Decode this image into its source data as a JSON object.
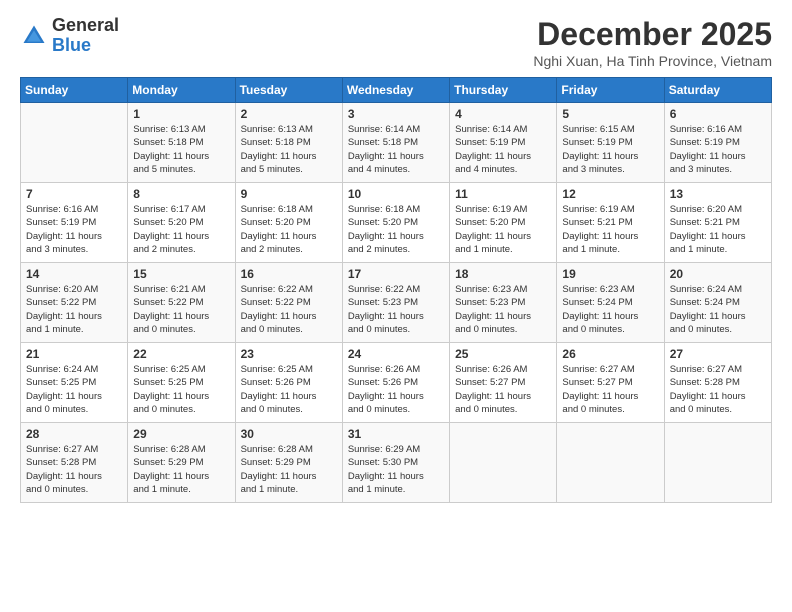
{
  "logo": {
    "general": "General",
    "blue": "Blue"
  },
  "header": {
    "month": "December 2025",
    "location": "Nghi Xuan, Ha Tinh Province, Vietnam"
  },
  "days": [
    "Sunday",
    "Monday",
    "Tuesday",
    "Wednesday",
    "Thursday",
    "Friday",
    "Saturday"
  ],
  "weeks": [
    [
      {
        "day": "",
        "content": ""
      },
      {
        "day": "1",
        "content": "Sunrise: 6:13 AM\nSunset: 5:18 PM\nDaylight: 11 hours\nand 5 minutes."
      },
      {
        "day": "2",
        "content": "Sunrise: 6:13 AM\nSunset: 5:18 PM\nDaylight: 11 hours\nand 5 minutes."
      },
      {
        "day": "3",
        "content": "Sunrise: 6:14 AM\nSunset: 5:18 PM\nDaylight: 11 hours\nand 4 minutes."
      },
      {
        "day": "4",
        "content": "Sunrise: 6:14 AM\nSunset: 5:19 PM\nDaylight: 11 hours\nand 4 minutes."
      },
      {
        "day": "5",
        "content": "Sunrise: 6:15 AM\nSunset: 5:19 PM\nDaylight: 11 hours\nand 3 minutes."
      },
      {
        "day": "6",
        "content": "Sunrise: 6:16 AM\nSunset: 5:19 PM\nDaylight: 11 hours\nand 3 minutes."
      }
    ],
    [
      {
        "day": "7",
        "content": "Sunrise: 6:16 AM\nSunset: 5:19 PM\nDaylight: 11 hours\nand 3 minutes."
      },
      {
        "day": "8",
        "content": "Sunrise: 6:17 AM\nSunset: 5:20 PM\nDaylight: 11 hours\nand 2 minutes."
      },
      {
        "day": "9",
        "content": "Sunrise: 6:18 AM\nSunset: 5:20 PM\nDaylight: 11 hours\nand 2 minutes."
      },
      {
        "day": "10",
        "content": "Sunrise: 6:18 AM\nSunset: 5:20 PM\nDaylight: 11 hours\nand 2 minutes."
      },
      {
        "day": "11",
        "content": "Sunrise: 6:19 AM\nSunset: 5:20 PM\nDaylight: 11 hours\nand 1 minute."
      },
      {
        "day": "12",
        "content": "Sunrise: 6:19 AM\nSunset: 5:21 PM\nDaylight: 11 hours\nand 1 minute."
      },
      {
        "day": "13",
        "content": "Sunrise: 6:20 AM\nSunset: 5:21 PM\nDaylight: 11 hours\nand 1 minute."
      }
    ],
    [
      {
        "day": "14",
        "content": "Sunrise: 6:20 AM\nSunset: 5:22 PM\nDaylight: 11 hours\nand 1 minute."
      },
      {
        "day": "15",
        "content": "Sunrise: 6:21 AM\nSunset: 5:22 PM\nDaylight: 11 hours\nand 0 minutes."
      },
      {
        "day": "16",
        "content": "Sunrise: 6:22 AM\nSunset: 5:22 PM\nDaylight: 11 hours\nand 0 minutes."
      },
      {
        "day": "17",
        "content": "Sunrise: 6:22 AM\nSunset: 5:23 PM\nDaylight: 11 hours\nand 0 minutes."
      },
      {
        "day": "18",
        "content": "Sunrise: 6:23 AM\nSunset: 5:23 PM\nDaylight: 11 hours\nand 0 minutes."
      },
      {
        "day": "19",
        "content": "Sunrise: 6:23 AM\nSunset: 5:24 PM\nDaylight: 11 hours\nand 0 minutes."
      },
      {
        "day": "20",
        "content": "Sunrise: 6:24 AM\nSunset: 5:24 PM\nDaylight: 11 hours\nand 0 minutes."
      }
    ],
    [
      {
        "day": "21",
        "content": "Sunrise: 6:24 AM\nSunset: 5:25 PM\nDaylight: 11 hours\nand 0 minutes."
      },
      {
        "day": "22",
        "content": "Sunrise: 6:25 AM\nSunset: 5:25 PM\nDaylight: 11 hours\nand 0 minutes."
      },
      {
        "day": "23",
        "content": "Sunrise: 6:25 AM\nSunset: 5:26 PM\nDaylight: 11 hours\nand 0 minutes."
      },
      {
        "day": "24",
        "content": "Sunrise: 6:26 AM\nSunset: 5:26 PM\nDaylight: 11 hours\nand 0 minutes."
      },
      {
        "day": "25",
        "content": "Sunrise: 6:26 AM\nSunset: 5:27 PM\nDaylight: 11 hours\nand 0 minutes."
      },
      {
        "day": "26",
        "content": "Sunrise: 6:27 AM\nSunset: 5:27 PM\nDaylight: 11 hours\nand 0 minutes."
      },
      {
        "day": "27",
        "content": "Sunrise: 6:27 AM\nSunset: 5:28 PM\nDaylight: 11 hours\nand 0 minutes."
      }
    ],
    [
      {
        "day": "28",
        "content": "Sunrise: 6:27 AM\nSunset: 5:28 PM\nDaylight: 11 hours\nand 0 minutes."
      },
      {
        "day": "29",
        "content": "Sunrise: 6:28 AM\nSunset: 5:29 PM\nDaylight: 11 hours\nand 1 minute."
      },
      {
        "day": "30",
        "content": "Sunrise: 6:28 AM\nSunset: 5:29 PM\nDaylight: 11 hours\nand 1 minute."
      },
      {
        "day": "31",
        "content": "Sunrise: 6:29 AM\nSunset: 5:30 PM\nDaylight: 11 hours\nand 1 minute."
      },
      {
        "day": "",
        "content": ""
      },
      {
        "day": "",
        "content": ""
      },
      {
        "day": "",
        "content": ""
      }
    ]
  ]
}
